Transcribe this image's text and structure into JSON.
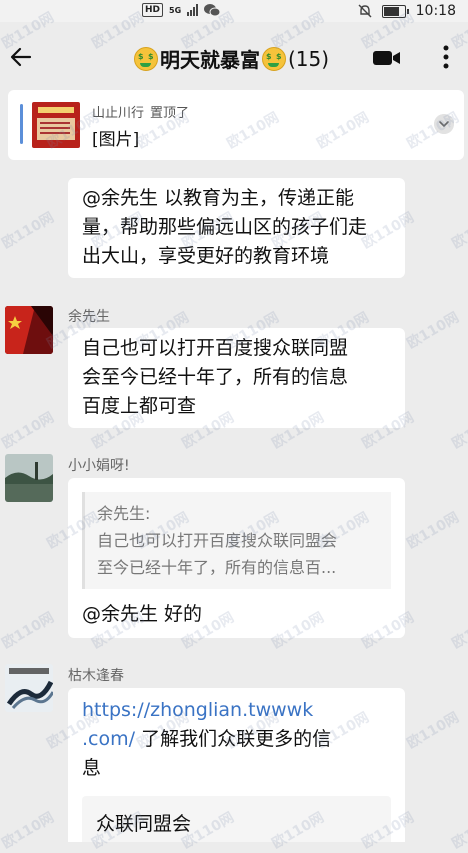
{
  "status_bar": {
    "network_badge": "HD",
    "network_type": "5G",
    "time": "10:18",
    "icons": [
      "signal-icon",
      "wechat-icon",
      "mute-icon",
      "battery-icon"
    ]
  },
  "header": {
    "title": "明天就暴富",
    "member_count": "(15)",
    "icons": [
      "back-arrow-icon",
      "money-face-emoji",
      "video-call-icon",
      "more-icon"
    ]
  },
  "pinned": {
    "author": "山止川行",
    "status": "置顶了",
    "content": "[图片]"
  },
  "messages": [
    {
      "id": "m1",
      "text_lines": [
        "@余先生  以教育为主，传递正能",
        "量，帮助那些偏远山区的孩子们走",
        "出大山，享受更好的教育环境"
      ]
    },
    {
      "id": "m2",
      "sender": "余先生",
      "text_lines": [
        "自己也可以打开百度搜众联同盟",
        "会至今已经十年了，所有的信息",
        "百度上都可查"
      ]
    },
    {
      "id": "m3",
      "sender": "小小娟呀!",
      "quote_sender": "余先生:",
      "quote_lines": [
        "自己也可以打开百度搜众联同盟会",
        "至今已经十年了，所有的信息百..."
      ],
      "text": "@余先生  好的"
    },
    {
      "id": "m4",
      "sender": "枯木逢春",
      "link_part1": "https://zhonglian.twwwk",
      "link_part2": ".com/",
      "text_after_link": "了解我们众联更多的信",
      "text_line3": "息",
      "card_title": "众联同盟会"
    }
  ],
  "watermark_text": "欧110网",
  "colors": {
    "background": "#ececec",
    "bubble": "#ffffff",
    "link": "#3a73c4",
    "pin_bar": "#5b8fd9"
  }
}
